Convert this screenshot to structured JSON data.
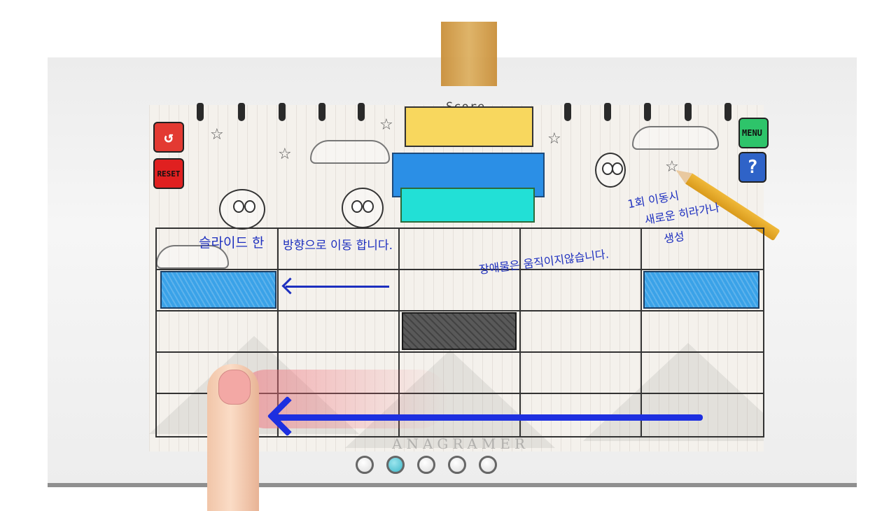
{
  "game": {
    "score_label": "Score",
    "watermark": "ANAGRAMER"
  },
  "buttons": {
    "undo_icon": "undo-icon",
    "reset_label": "RESET",
    "menu_label": "MENU",
    "help_label": "?"
  },
  "hints": {
    "slide": "슬라이드 한",
    "move": "방향으로 이동 합니다.",
    "obstacle": "장애물은 움직이지않습니다.",
    "spawn_line1": "1회 이동시",
    "spawn_line2": "새로운 히라가나",
    "spawn_line3": "생성"
  },
  "tutorial": {
    "pages_total": 5,
    "current_page": 2
  },
  "colors": {
    "score_bar": "#f8d75e",
    "block_blue": "#2b8fe6",
    "block_cyan": "#22e0d6",
    "hint_ink": "#1d2fbf",
    "arrow": "#1d2fe0"
  }
}
